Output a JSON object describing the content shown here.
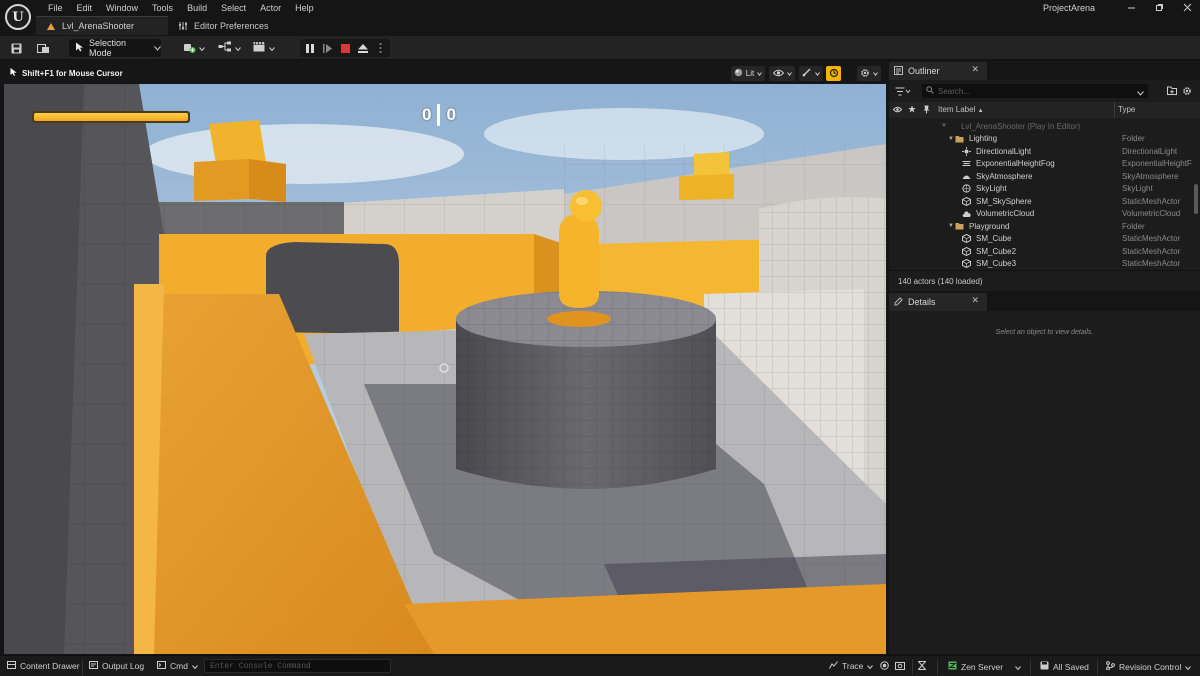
{
  "menu": [
    "File",
    "Edit",
    "Window",
    "Tools",
    "Build",
    "Select",
    "Actor",
    "Help"
  ],
  "window": {
    "project_name": "ProjectArena"
  },
  "tabs": {
    "level": "Lvl_ArenaShooter",
    "preferences": "Editor Preferences"
  },
  "toolbar": {
    "selection_mode": "Selection Mode"
  },
  "viewport": {
    "hint": "Shift+F1 for Mouse Cursor",
    "view_mode": "Lit",
    "hud": {
      "health_fraction": 1.0,
      "score_left": "0",
      "score_right": "0"
    }
  },
  "outliner": {
    "tab_label": "Outliner",
    "search_placeholder": "Search...",
    "col_item_label": "Item Label",
    "col_type": "Type",
    "rows": [
      {
        "label": "Lvl_ArenaShooter (Play In Editor)",
        "type": ""
      },
      {
        "label": "Lighting",
        "type": "Folder"
      },
      {
        "label": "DirectionalLight",
        "type": "DirectionalLight"
      },
      {
        "label": "ExponentialHeightFog",
        "type": "ExponentialHeightF"
      },
      {
        "label": "SkyAtmosphere",
        "type": "SkyAtmosphere"
      },
      {
        "label": "SkyLight",
        "type": "SkyLight"
      },
      {
        "label": "SM_SkySphere",
        "type": "StaticMeshActor"
      },
      {
        "label": "VolumetricCloud",
        "type": "VolumetricCloud"
      },
      {
        "label": "Playground",
        "type": "Folder"
      },
      {
        "label": "SM_Cube",
        "type": "StaticMeshActor"
      },
      {
        "label": "SM_Cube2",
        "type": "StaticMeshActor"
      },
      {
        "label": "SM_Cube3",
        "type": "StaticMeshActor"
      }
    ],
    "actor_count": "140 actors (140 loaded)"
  },
  "details": {
    "tab_label": "Details",
    "empty_message": "Select an object to view details."
  },
  "statusbar": {
    "content_drawer": "Content Drawer",
    "output_log": "Output Log",
    "cmd": "Cmd",
    "console_placeholder": "Enter Console Command",
    "trace": "Trace",
    "zen_server": "Zen Server",
    "all_saved": "All Saved",
    "revision_control": "Revision Control"
  },
  "colors": {
    "accent_orange": "#f3a81e",
    "editor_bg": "#1c1c1c",
    "stop_red": "#e0353b",
    "realtime_yellow": "#f5b300",
    "zen_green": "#4cbb57"
  }
}
